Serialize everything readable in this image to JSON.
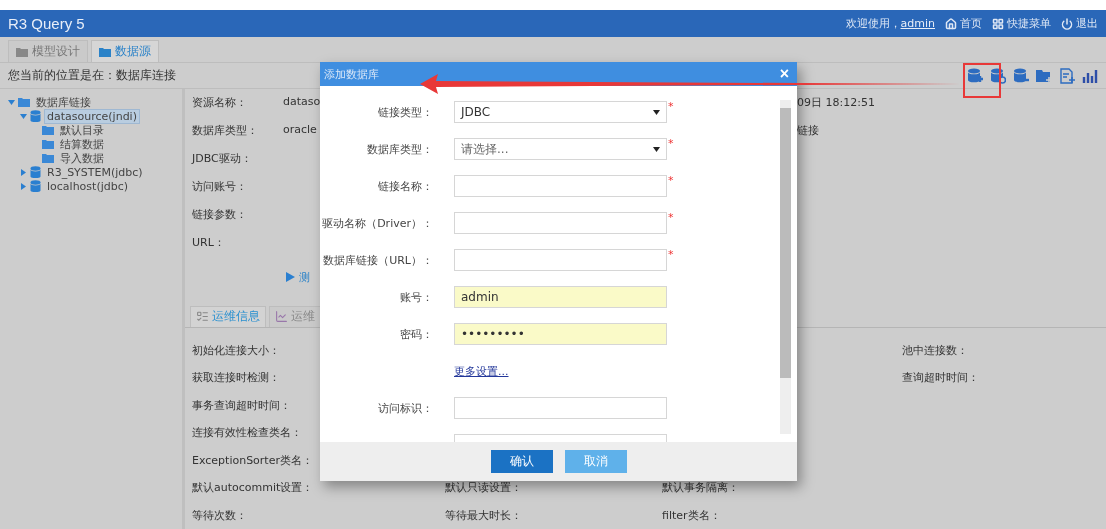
{
  "header": {
    "title": "R3 Query 5",
    "greeting": "欢迎使用，",
    "user": "admin",
    "links": [
      {
        "label": "首页"
      },
      {
        "label": "快捷菜单"
      },
      {
        "label": "退出"
      }
    ]
  },
  "tabs": [
    {
      "label": "模型设计",
      "selected": false
    },
    {
      "label": "数据源",
      "selected": true
    }
  ],
  "breadcrumb": "您当前的位置是在：数据库连接",
  "tree": [
    {
      "label": "数据库链接",
      "kind": "folder",
      "expanded": true,
      "selected": false,
      "children": [
        {
          "label": "datasource(jndi)",
          "kind": "database",
          "expanded": true,
          "selected": true,
          "children": [
            {
              "label": "默认目录",
              "kind": "folder",
              "selected": false
            },
            {
              "label": "结算数据",
              "kind": "folder",
              "selected": false
            },
            {
              "label": "导入数据",
              "kind": "folder",
              "selected": false
            }
          ]
        },
        {
          "label": "R3_SYSTEM(jdbc)",
          "kind": "database",
          "expanded": false,
          "selected": false
        },
        {
          "label": "localhost(jdbc)",
          "kind": "database",
          "expanded": false,
          "selected": false
        }
      ]
    }
  ],
  "details": {
    "rows": [
      {
        "label": "资源名称：",
        "value": "dataso",
        "extra": "09日 18:12:51"
      },
      {
        "label": "数据库类型：",
        "value": "oracle",
        "extra": "链接"
      },
      {
        "label": "JDBC驱动："
      },
      {
        "label": "访问账号："
      },
      {
        "label": "链接参数："
      },
      {
        "label": "URL："
      }
    ],
    "test_link": "测"
  },
  "ops_tabs": [
    {
      "label": "运维信息",
      "selected": true
    },
    {
      "label": "运维",
      "selected": false
    }
  ],
  "ops_rows": [
    {
      "column_1": "初始化连接大小：",
      "column_4": "池中连接数："
    },
    {
      "column_1": "获取连接时检测：",
      "column_4": "查询超时时间："
    },
    {
      "column_1": "事务查询超时时间："
    },
    {
      "column_1": "连接有效性检查类名："
    },
    {
      "column_1": "ExceptionSorter类名："
    },
    {
      "column_1": "默认autocommit设置：",
      "column_2": "默认只读设置：",
      "column_3": "默认事务隔离："
    },
    {
      "column_1": "等待次数：",
      "column_2": "等待最大时长：",
      "column_3": "filter类名："
    }
  ],
  "dialog": {
    "title": "添加数据库",
    "close": "×",
    "fields": [
      {
        "label": "链接类型：",
        "kind": "select",
        "value": "JDBC",
        "required_mark": "*"
      },
      {
        "label": "数据库类型：",
        "kind": "select",
        "placeholder": "请选择...",
        "required_mark": "*"
      },
      {
        "label": "链接名称：",
        "kind": "text",
        "required_mark": "*"
      },
      {
        "label": "驱动名称（Driver）：",
        "kind": "text",
        "required_mark": "*"
      },
      {
        "label": "数据库链接（URL）：",
        "kind": "text",
        "required_mark": "*"
      },
      {
        "label": "账号：",
        "kind": "text",
        "value": "admin",
        "autofilled": true
      },
      {
        "label": "密码：",
        "kind": "text",
        "value": "•••••••••",
        "autofilled": true
      },
      {
        "label": "更多设置...",
        "kind": "link"
      },
      {
        "label": "访问标识：",
        "kind": "text",
        "autofilled": false
      },
      {
        "kind": "text",
        "autofilled": false
      }
    ],
    "buttons": [
      {
        "label": "确认",
        "primary": true
      },
      {
        "label": "取消",
        "primary": false
      }
    ]
  }
}
